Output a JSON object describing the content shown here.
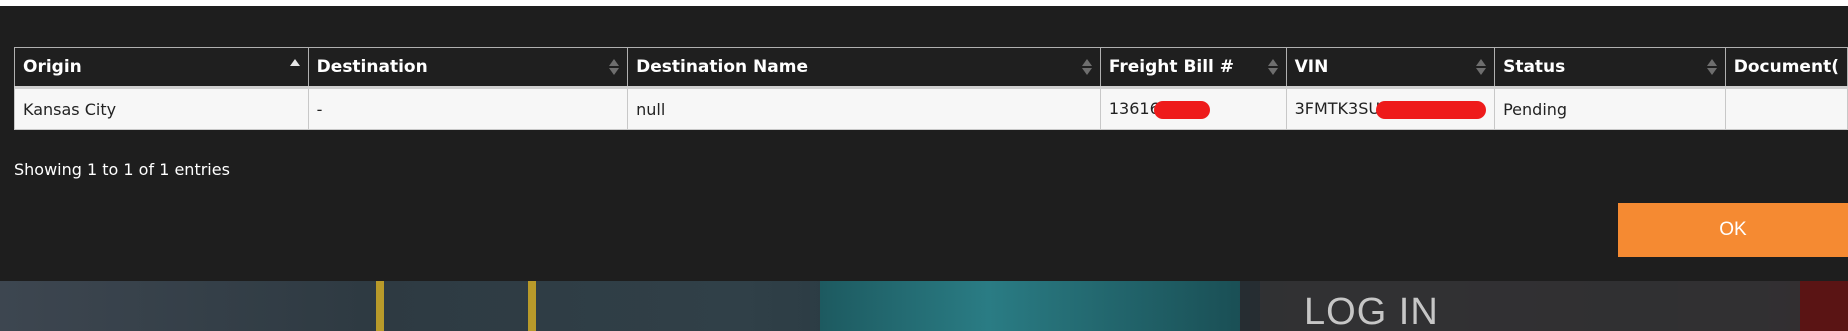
{
  "table": {
    "columns": [
      {
        "label": "Origin",
        "sort": "asc"
      },
      {
        "label": "Destination",
        "sort": "none"
      },
      {
        "label": "Destination Name",
        "sort": "none"
      },
      {
        "label": "Freight Bill #",
        "sort": "none"
      },
      {
        "label": "VIN",
        "sort": "none"
      },
      {
        "label": "Status",
        "sort": "none"
      },
      {
        "label": "Document(",
        "sort": "none"
      }
    ],
    "rows": [
      {
        "origin": "Kansas City",
        "destination": "-",
        "destination_name": "null",
        "freight_bill": "13616",
        "vin": "3FMTK3SU",
        "status": "Pending",
        "documents": ""
      }
    ]
  },
  "info_text": "Showing 1 to 1 of 1 entries",
  "ok_label": "OK",
  "background": {
    "login_heading": "LOG IN"
  },
  "colors": {
    "modal_bg": "#1e1e1e",
    "ok_button": "#f58a32",
    "redaction": "#ee1b1b"
  }
}
